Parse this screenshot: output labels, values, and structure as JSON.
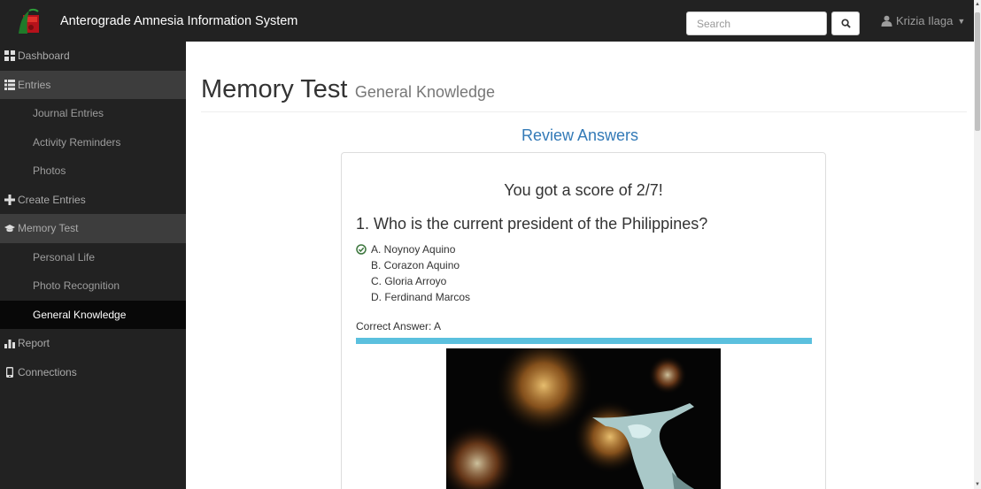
{
  "app": {
    "title": "Anterograde Amnesia Information System"
  },
  "navbar": {
    "search_placeholder": "Search",
    "user_name": "Krizia Ilaga"
  },
  "sidebar": {
    "items": [
      {
        "label": "Dashboard",
        "icon": "dashboard-icon"
      },
      {
        "label": "Entries",
        "icon": "list-icon"
      },
      {
        "label": "Journal Entries"
      },
      {
        "label": "Activity Reminders"
      },
      {
        "label": "Photos"
      },
      {
        "label": "Create Entries",
        "icon": "plus-icon"
      },
      {
        "label": "Memory Test",
        "icon": "graduation-cap-icon"
      },
      {
        "label": "Personal Life"
      },
      {
        "label": "Photo Recognition"
      },
      {
        "label": "General Knowledge"
      },
      {
        "label": "Report",
        "icon": "bar-chart-icon"
      },
      {
        "label": "Connections",
        "icon": "phone-icon"
      }
    ]
  },
  "page": {
    "title": "Memory Test",
    "subtitle": "General Knowledge",
    "review_heading": "Review Answers"
  },
  "result": {
    "score_text": "You got a score of 2/7!",
    "question": "1. Who is the current president of the Philippines?",
    "choices": [
      "A. Noynoy Aquino",
      "B. Corazon Aquino",
      "C. Gloria Arroyo",
      "D. Ferdinand Marcos"
    ],
    "selected_choice": "A",
    "correct_answer": "Correct Answer: A"
  },
  "colors": {
    "navbar": "#222222",
    "link": "#337ab7",
    "progress": "#5bc0de",
    "check": "#3c763d"
  }
}
